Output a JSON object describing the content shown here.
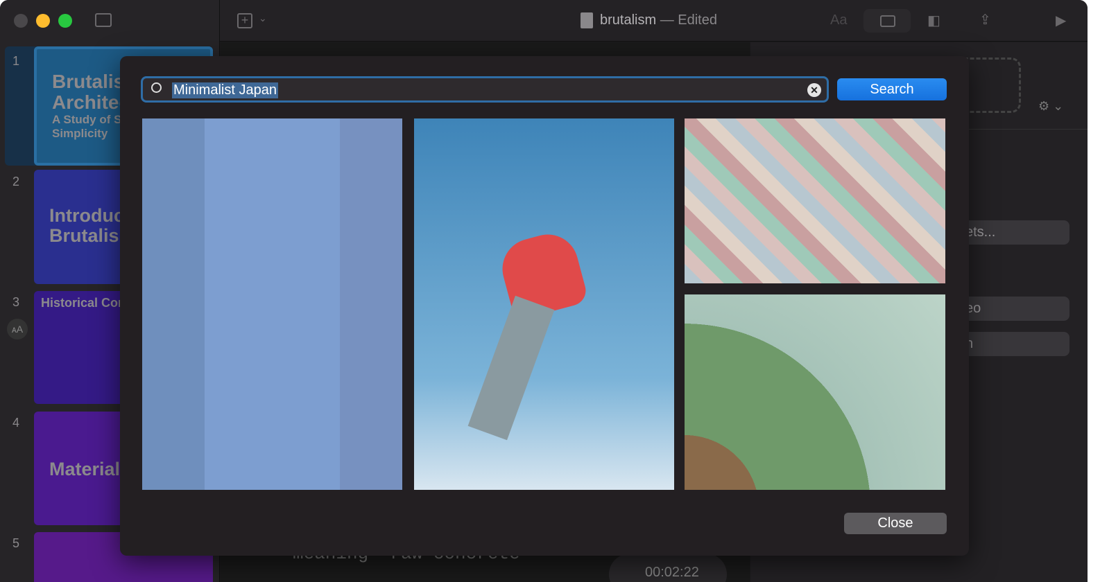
{
  "window": {
    "doc_title": "brutalism",
    "doc_status": "Edited"
  },
  "toolbar": {
    "text_format": "Aa"
  },
  "slides": [
    {
      "num": "1",
      "title": "Brutalist Architecture",
      "subtitle": "A Study of Structural Simplicity",
      "color": "#1d5a85"
    },
    {
      "num": "2",
      "title": "Introduction to Brutalism",
      "color": "#2a2f8f"
    },
    {
      "num": "3",
      "title": "Historical Context",
      "color": "#341a86"
    },
    {
      "num": "4",
      "title": "Materials",
      "color": "#4a1a8f"
    },
    {
      "num": "5",
      "title": "",
      "color": "#561a8a"
    }
  ],
  "canvas": {
    "notes_text": "meaning \"raw concrete\"",
    "timer": "00:02:22"
  },
  "inspector": {
    "placeholder_tail": "e",
    "assets_tail": "ets...",
    "video_tail": "eo",
    "search_tail": "h"
  },
  "dialog": {
    "search_value": "Minimalist Japan",
    "search_button": "Search",
    "close_button": "Close",
    "results": [
      "Blue building facade with windows",
      "Person jumping against sky",
      "Colorful diamond tiles",
      "Velodrome cyclists"
    ]
  }
}
